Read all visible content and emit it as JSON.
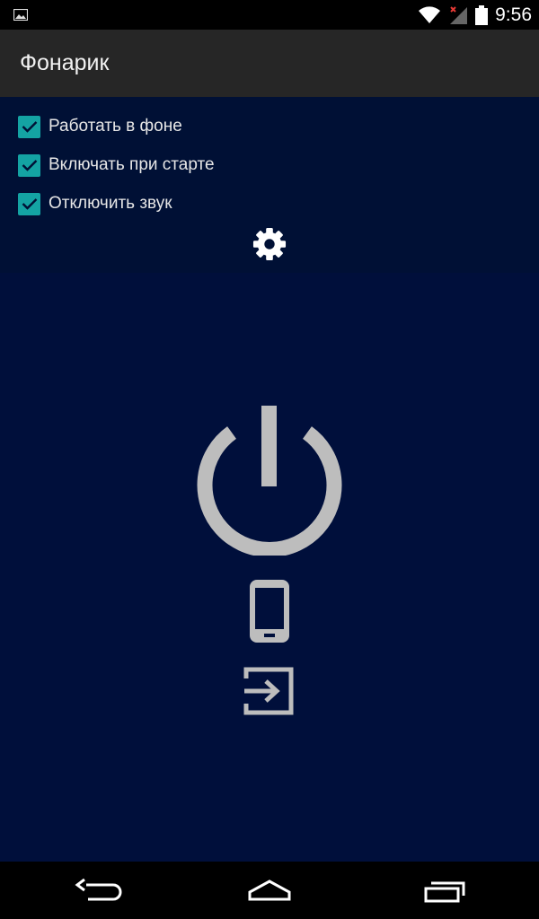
{
  "status_bar": {
    "time": "9:56",
    "icons": [
      "image-notification-icon",
      "wifi-icon",
      "signal-no-data-icon",
      "battery-icon"
    ]
  },
  "app": {
    "title": "Фонарик"
  },
  "settings": {
    "options": [
      {
        "label": "Работать в фоне",
        "checked": true
      },
      {
        "label": "Включать при старте",
        "checked": true
      },
      {
        "label": "Отключить звук",
        "checked": true
      }
    ],
    "settings_icon": "gear-icon"
  },
  "main": {
    "power_icon": "power-icon",
    "phone_icon": "phone-icon",
    "exit_icon": "exit-icon"
  },
  "navigation": {
    "icons": [
      "back-icon",
      "home-icon",
      "recents-icon"
    ]
  },
  "colors": {
    "status_bar_bg": "#000000",
    "action_bar_bg": "#262626",
    "settings_bg": "#001035",
    "main_bg": "#000f3b",
    "checkbox_accent": "#14a3a3",
    "icon_gray": "#bdbdbd"
  }
}
